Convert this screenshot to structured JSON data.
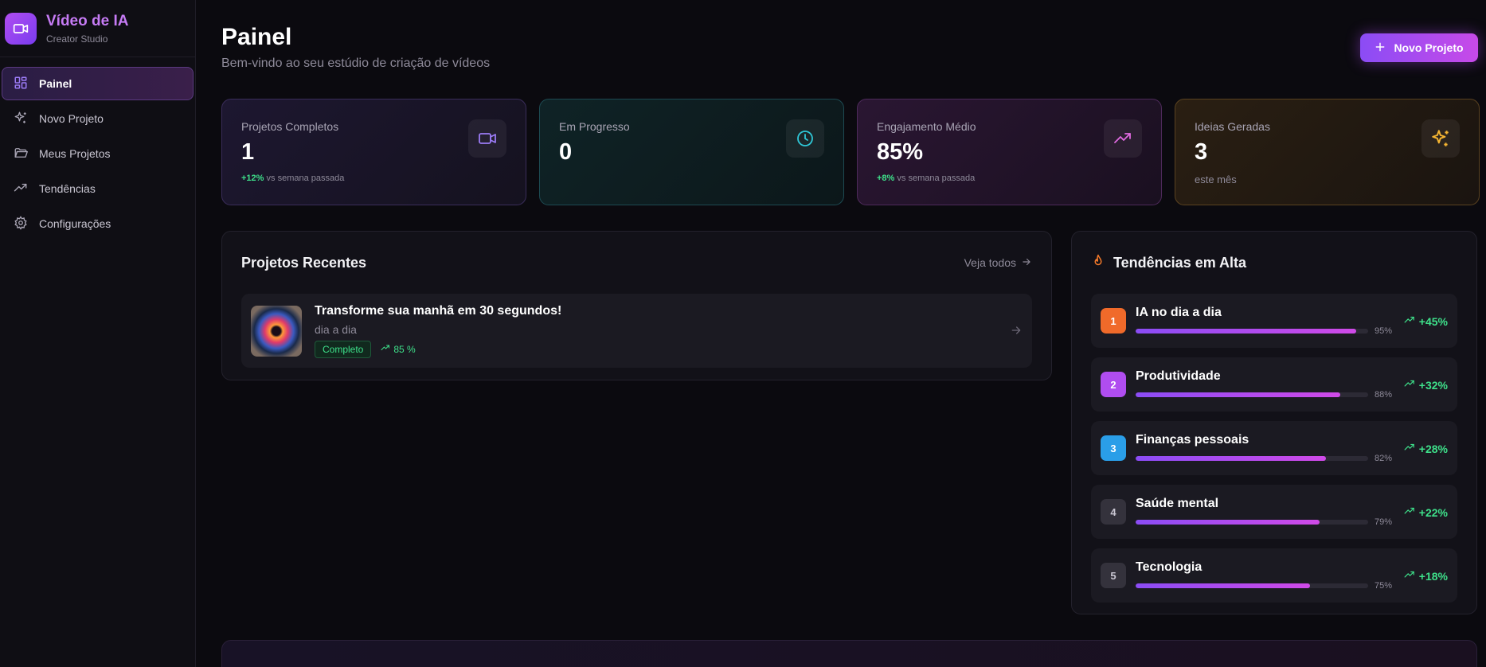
{
  "brand": {
    "title": "Vídeo de IA",
    "subtitle": "Creator Studio",
    "logo_icon": "video-camera-icon"
  },
  "sidebar": {
    "items": [
      {
        "label": "Painel",
        "icon": "dashboard-grid-icon",
        "active": true
      },
      {
        "label": "Novo Projeto",
        "icon": "sparkles-icon",
        "active": false
      },
      {
        "label": "Meus Projetos",
        "icon": "folder-open-icon",
        "active": false
      },
      {
        "label": "Tendências",
        "icon": "trending-up-icon",
        "active": false
      },
      {
        "label": "Configurações",
        "icon": "gear-icon",
        "active": false
      }
    ]
  },
  "header": {
    "title": "Painel",
    "subtitle": "Bem-vindo ao seu estúdio de criação de vídeos",
    "new_project_label": "Novo Projeto"
  },
  "stats": [
    {
      "label": "Projetos Completos",
      "value": "1",
      "delta": "+12%",
      "note": "vs semana passada",
      "icon": "video-camera-icon",
      "accent": "#9b7bf5"
    },
    {
      "label": "Em Progresso",
      "value": "0",
      "delta": "",
      "note": "",
      "icon": "clock-icon",
      "accent": "#2fc8d8"
    },
    {
      "label": "Engajamento Médio",
      "value": "85%",
      "delta": "+8%",
      "note": "vs semana passada",
      "icon": "trending-up-icon",
      "accent": "#e06ae0"
    },
    {
      "label": "Ideias Geradas",
      "value": "3",
      "delta": "",
      "note": "este mês",
      "icon": "sparkles-icon",
      "accent": "#f5b532"
    }
  ],
  "recent": {
    "title": "Projetos Recentes",
    "see_all": "Veja todos",
    "projects": [
      {
        "title": "Transforme sua manhã em 30 segundos!",
        "category": "dia a dia",
        "status": "Completo",
        "engagement": "85 %"
      }
    ]
  },
  "trends": {
    "title": "Tendências em Alta",
    "items": [
      {
        "rank": "1",
        "name": "IA no dia a dia",
        "score": 95,
        "score_label": "95%",
        "delta": "+45%",
        "color": "#f06a2a"
      },
      {
        "rank": "2",
        "name": "Produtividade",
        "score": 88,
        "score_label": "88%",
        "delta": "+32%",
        "color": "#b04df0"
      },
      {
        "rank": "3",
        "name": "Finanças pessoais",
        "score": 82,
        "score_label": "82%",
        "delta": "+28%",
        "color": "#2a9ee8"
      },
      {
        "rank": "4",
        "name": "Saúde mental",
        "score": 79,
        "score_label": "79%",
        "delta": "+22%",
        "color": "#34323c"
      },
      {
        "rank": "5",
        "name": "Tecnologia",
        "score": 75,
        "score_label": "75%",
        "delta": "+18%",
        "color": "#34323c"
      }
    ]
  }
}
